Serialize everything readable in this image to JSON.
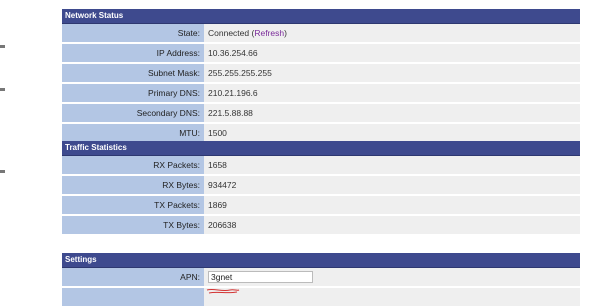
{
  "network_status": {
    "header": "Network Status",
    "state": {
      "label": "State:",
      "value": "Connected",
      "open_paren": " (",
      "refresh_label": "Refresh",
      "close_paren": ")"
    },
    "rows": [
      {
        "label": "IP Address:",
        "value": "10.36.254.66"
      },
      {
        "label": "Subnet Mask:",
        "value": "255.255.255.255"
      },
      {
        "label": "Primary DNS:",
        "value": "210.21.196.6"
      },
      {
        "label": "Secondary DNS:",
        "value": "221.5.88.88"
      },
      {
        "label": "MTU:",
        "value": "1500"
      }
    ]
  },
  "traffic_statistics": {
    "header": "Traffic Statistics",
    "rows": [
      {
        "label": "RX Packets:",
        "value": "1658"
      },
      {
        "label": "RX Bytes:",
        "value": "934472"
      },
      {
        "label": "TX Packets:",
        "value": "1869"
      },
      {
        "label": "TX Bytes:",
        "value": "206638"
      }
    ]
  },
  "settings": {
    "header": "Settings",
    "apn": {
      "label": "APN:",
      "value": "3gnet"
    }
  },
  "colors": {
    "header_bg": "#3e4a8e",
    "label_bg": "#b3c6e4",
    "value_bg": "#efefef",
    "link": "#7a2a9a",
    "annotation": "#d33333"
  }
}
